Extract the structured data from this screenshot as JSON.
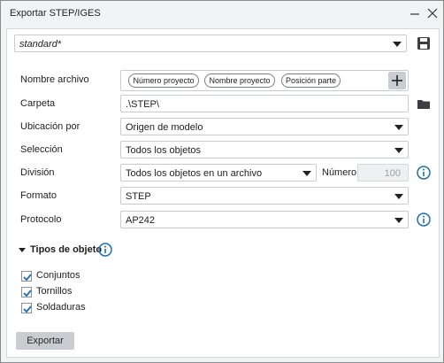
{
  "window": {
    "title": "Exportar STEP/IGES"
  },
  "preset": {
    "value": "standard*"
  },
  "form": {
    "filename_label": "Nombre archivo",
    "filename_chips": [
      "Número proyecto",
      "Nombre proyecto",
      "Posición parte"
    ],
    "folder_label": "Carpeta",
    "folder_value": ".\\STEP\\",
    "location_label": "Ubicación por",
    "location_value": "Origen de modelo",
    "selection_label": "Selección",
    "selection_value": "Todos los objetos",
    "division_label": "División",
    "division_value": "Todos los objetos en un archivo",
    "number_label": "Número",
    "number_value": "100",
    "format_label": "Formato",
    "format_value": "STEP",
    "protocol_label": "Protocolo",
    "protocol_value": "AP242"
  },
  "object_types": {
    "title": "Tipos de objeto",
    "items": [
      {
        "label": "Conjuntos",
        "checked": true
      },
      {
        "label": "Tornillos",
        "checked": true
      },
      {
        "label": "Soldaduras",
        "checked": true
      }
    ]
  },
  "export_label": "Exportar",
  "colors": {
    "info_blue": "#1a6fb5",
    "button_gray": "#c9ccd0"
  }
}
